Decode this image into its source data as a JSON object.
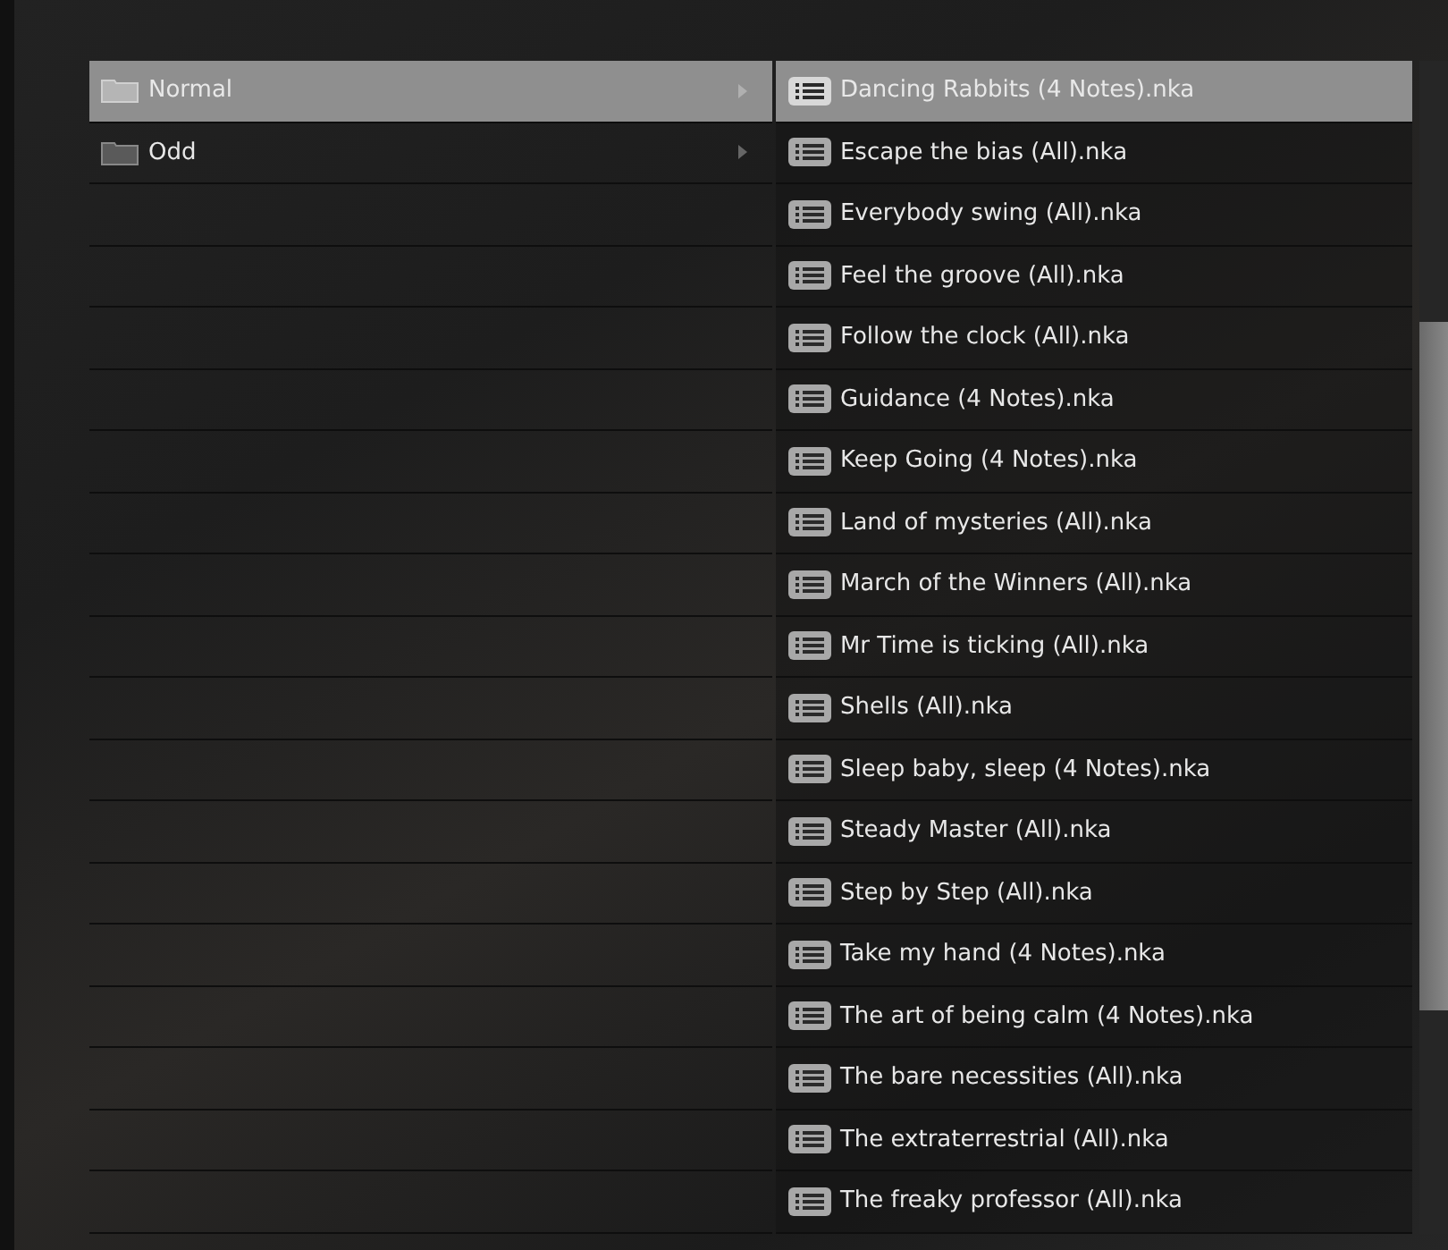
{
  "folders": [
    {
      "label": "Normal",
      "selected": true
    },
    {
      "label": "Odd",
      "selected": false
    }
  ],
  "files": [
    {
      "label": "Dancing Rabbits (4 Notes).nka",
      "selected": true
    },
    {
      "label": "Escape the bias (All).nka",
      "selected": false
    },
    {
      "label": "Everybody swing (All).nka",
      "selected": false
    },
    {
      "label": "Feel the groove (All).nka",
      "selected": false
    },
    {
      "label": "Follow the clock (All).nka",
      "selected": false
    },
    {
      "label": "Guidance (4 Notes).nka",
      "selected": false
    },
    {
      "label": "Keep Going (4 Notes).nka",
      "selected": false
    },
    {
      "label": "Land of mysteries (All).nka",
      "selected": false
    },
    {
      "label": "March of the Winners (All).nka",
      "selected": false
    },
    {
      "label": "Mr Time is ticking (All).nka",
      "selected": false
    },
    {
      "label": "Shells (All).nka",
      "selected": false
    },
    {
      "label": "Sleep baby, sleep (4 Notes).nka",
      "selected": false
    },
    {
      "label": "Steady Master (All).nka",
      "selected": false
    },
    {
      "label": "Step by Step (All).nka",
      "selected": false
    },
    {
      "label": "Take my hand (4 Notes).nka",
      "selected": false
    },
    {
      "label": "The art of being calm (4 Notes).nka",
      "selected": false
    },
    {
      "label": "The bare necessities (All).nka",
      "selected": false
    },
    {
      "label": "The extraterrestrial (All).nka",
      "selected": false
    },
    {
      "label": "The freaky professor (All).nka",
      "selected": false
    }
  ]
}
